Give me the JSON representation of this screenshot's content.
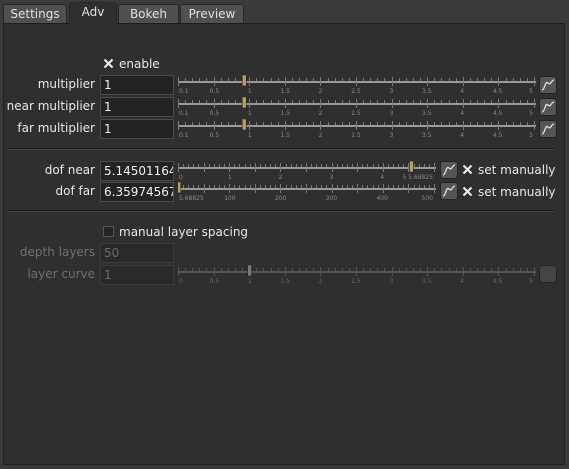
{
  "tabs": [
    {
      "label": "Settings",
      "active": false
    },
    {
      "label": "Adv",
      "active": true
    },
    {
      "label": "Bokeh",
      "active": false
    },
    {
      "label": "Preview",
      "active": false
    }
  ],
  "enable": {
    "label": "enable",
    "checked": true
  },
  "multiplier": {
    "label": "multiplier",
    "value": "1",
    "ticks": [
      "0.1",
      "0.5",
      "1",
      "1.5",
      "2",
      "2.5",
      "3",
      "3.5",
      "4",
      "4.5",
      "5"
    ]
  },
  "near_multiplier": {
    "label": "near multiplier",
    "value": "1",
    "ticks": [
      "0.1",
      "0.5",
      "1",
      "1.5",
      "2",
      "2.5",
      "3",
      "3.5",
      "4",
      "4.5",
      "5"
    ]
  },
  "far_multiplier": {
    "label": "far multiplier",
    "value": "1",
    "ticks": [
      "0.1",
      "0.5",
      "1",
      "1.5",
      "2",
      "2.5",
      "3",
      "3.5",
      "4",
      "4.5",
      "5"
    ]
  },
  "dof_near": {
    "label": "dof near",
    "value": "5.14501164",
    "ticks": [
      "0",
      "1",
      "2",
      "3",
      "4",
      "5 5.68825"
    ],
    "set_manually": {
      "label": "set manually",
      "checked": true
    }
  },
  "dof_far": {
    "label": "dof far",
    "value": "6.35974567",
    "ticks": [
      "5.68825",
      "100",
      "200",
      "300",
      "400",
      "500"
    ],
    "set_manually": {
      "label": "set manually",
      "checked": true
    }
  },
  "manual_layer_spacing": {
    "label": "manual layer spacing",
    "checked": false
  },
  "depth_layers": {
    "label": "depth layers",
    "value": "50"
  },
  "layer_curve": {
    "label": "layer curve",
    "value": "1",
    "ticks": [
      "0",
      "0.5",
      "1",
      "1.5",
      "2",
      "2.5",
      "3",
      "3.5",
      "4",
      "4.5",
      "5"
    ]
  },
  "colors": {
    "handle": "#b8a060",
    "track": "#1a1a1a",
    "panel": "#2f2f2f"
  }
}
